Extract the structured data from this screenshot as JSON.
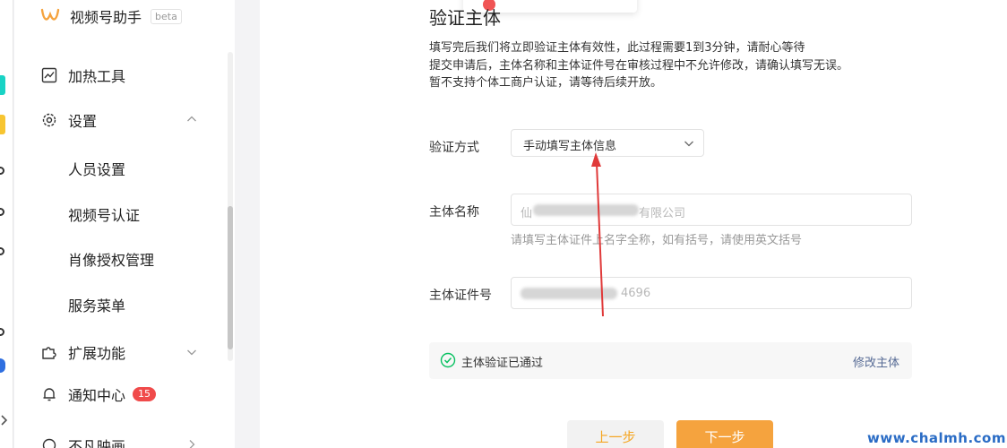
{
  "sidebar": {
    "brand": {
      "name": "视频号助手",
      "badge": "beta"
    },
    "items": [
      {
        "label": "加热工具"
      },
      {
        "label": "设置"
      },
      {
        "label": "扩展功能"
      },
      {
        "label": "通知中心",
        "badge": "15"
      },
      {
        "label": "不凡映画"
      }
    ],
    "sub_items": [
      {
        "label": "人员设置"
      },
      {
        "label": "视频号认证"
      },
      {
        "label": "肖像授权管理"
      },
      {
        "label": "服务菜单"
      }
    ]
  },
  "main": {
    "section_title": "验证主体",
    "description": [
      "填写完后我们将立即验证主体有效性，此过程需要1到3分钟，请耐心等待",
      "提交申请后，主体名称和主体证件号在审核过程中不允许修改，请确认填写无误。",
      "暂不支持个体工商户认证，请等待后续开放。"
    ],
    "verify_method": {
      "label": "验证方式",
      "value": "手动填写主体信息"
    },
    "entity_name": {
      "label": "主体名称",
      "value_visible_start": "仙",
      "value_visible_end": "有限公司",
      "hint": "请填写主体证件上名字全称，如有括号，请使用英文括号"
    },
    "entity_id": {
      "label": "主体证件号",
      "value_visible_end": "4696"
    },
    "status": {
      "text": "主体验证已通过",
      "link": "修改主体"
    },
    "buttons": {
      "prev": "上一步",
      "next": "下一步"
    }
  },
  "watermark": "www.chalmh.com",
  "colors": {
    "accent": "#f5a33e",
    "link": "#576b95",
    "success": "#07c160",
    "badge": "#f04a4a",
    "annotation_arrow": "#e03a3a"
  }
}
